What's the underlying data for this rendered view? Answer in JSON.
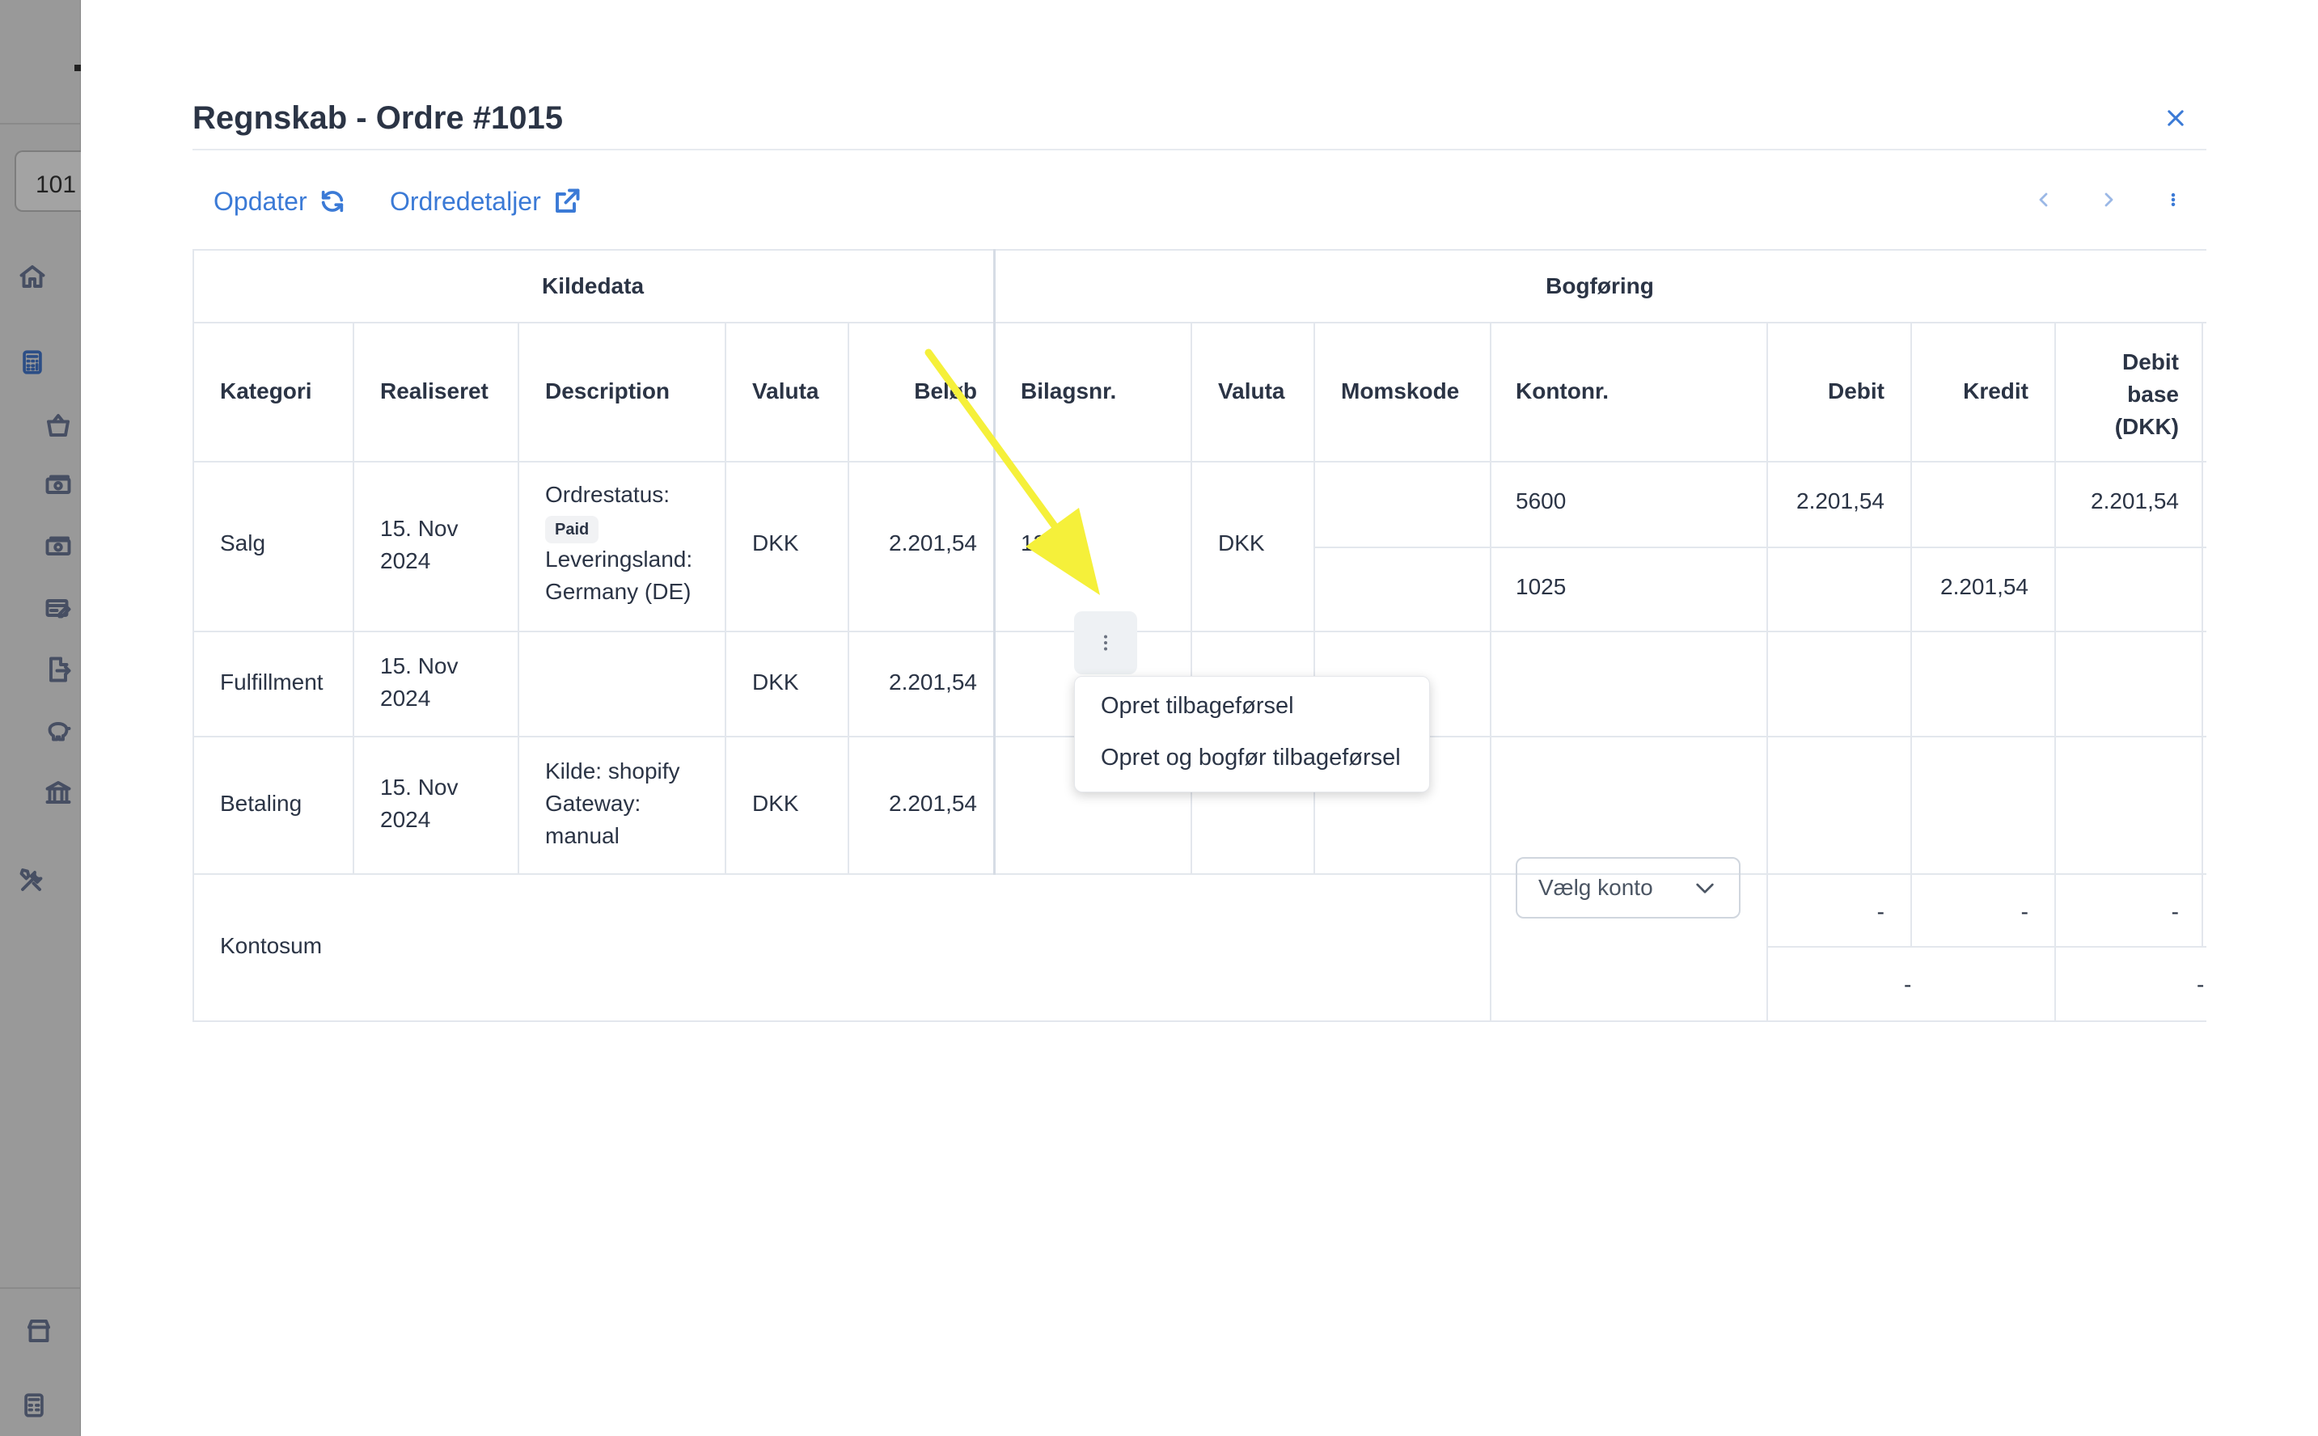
{
  "sidebar": {
    "search_value": "101",
    "icons": [
      "home-icon",
      "calculator-icon",
      "basket-icon",
      "cash-icon",
      "cash-alt-icon",
      "card-edit-icon",
      "document-export-icon",
      "piggy-bank-icon",
      "bank-icon",
      "tools-icon",
      "store-icon",
      "calculator-alt-icon"
    ]
  },
  "dialog": {
    "title": "Regnskab - Ordre #1015",
    "toolbar": {
      "refresh_label": "Opdater",
      "details_label": "Ordredetaljer"
    }
  },
  "table": {
    "groups": {
      "source": "Kildedata",
      "posting": "Bogføring"
    },
    "headers": {
      "kategori": "Kategori",
      "realiseret": "Realiseret",
      "description": "Description",
      "valuta": "Valuta",
      "beloeb": "Beløb",
      "bilagsnr": "Bilagsnr.",
      "valuta2": "Valuta",
      "momskode": "Momskode",
      "kontonr": "Kontonr.",
      "debit": "Debit",
      "kredit": "Kredit",
      "debit_base": "Debit base (DKK)"
    },
    "rows": [
      {
        "kategori": "Salg",
        "realiseret": "15. Nov 2024",
        "desc_label": "Ordrestatus:",
        "desc_badge": "Paid",
        "desc_rest": "Leveringsland: Germany (DE)",
        "valuta": "DKK",
        "beloeb": "2.201,54",
        "bilagsnr": "13",
        "valuta2": "DKK",
        "lines": [
          {
            "kontonr": "5600",
            "debit": "2.201,54",
            "kredit": "",
            "debit_base": "2.201,54"
          },
          {
            "kontonr": "1025",
            "debit": "",
            "kredit": "2.201,54",
            "debit_base": ""
          }
        ]
      },
      {
        "kategori": "Fulfillment",
        "realiseret": "15. Nov 2024",
        "description": "",
        "valuta": "DKK",
        "beloeb": "2.201,54"
      },
      {
        "kategori": "Betaling",
        "realiseret": "15. Nov 2024",
        "description": "Kilde: shopify Gateway: manual",
        "valuta": "DKK",
        "beloeb": "2.201,54"
      }
    ],
    "footer": {
      "label": "Kontosum",
      "select_placeholder": "Vælg konto",
      "debit": "-",
      "kredit": "-",
      "debit_base": "-",
      "sum1": "-",
      "sum2": "-"
    }
  },
  "context_menu": {
    "items": [
      "Opret tilbageførsel",
      "Opret og bogfør tilbageførsel"
    ]
  },
  "annotation": {
    "arrow_color": "#f5f03a"
  }
}
